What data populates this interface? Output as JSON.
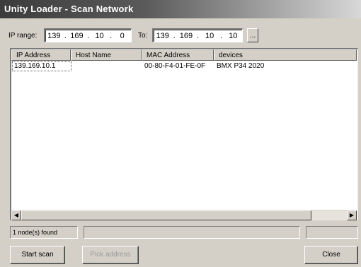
{
  "window": {
    "title": "Unity Loader - Scan Network"
  },
  "range": {
    "ip_range_label": "IP range:",
    "from": [
      "139",
      "169",
      "10",
      "0"
    ],
    "to_label": "To:",
    "to": [
      "139",
      "169",
      "10",
      "10"
    ],
    "browse_label": "..."
  },
  "table": {
    "columns": [
      "IP Address",
      "Host Name",
      "MAC Address",
      "devices"
    ],
    "rows": [
      {
        "ip": "139.169.10.1",
        "host": "",
        "mac": "00-80-F4-01-FE-0F",
        "device": "BMX P34 2020"
      }
    ]
  },
  "status": {
    "nodes_found": "1 node(s) found"
  },
  "buttons": {
    "start_scan": "Start scan",
    "pick_address": "Pick address",
    "close": "Close"
  },
  "colors": {
    "window_bg": "#d4d0c8",
    "title_dark": "#3c3c3c",
    "disabled_text": "#9a9a9a"
  }
}
